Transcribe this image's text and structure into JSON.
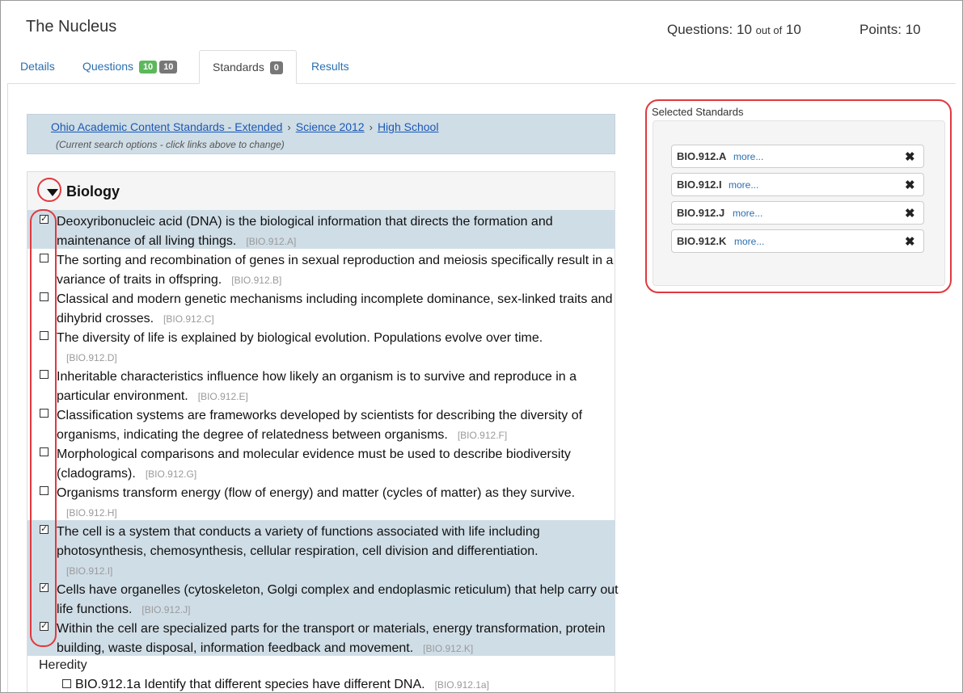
{
  "header": {
    "title": "The Nucleus",
    "questions_label": "Questions:",
    "questions_count": "10",
    "questions_outof": "out of",
    "questions_total": "10",
    "points_label": "Points:",
    "points_value": "10"
  },
  "tabs": [
    {
      "label": "Details"
    },
    {
      "label": "Questions",
      "badge_green": "10",
      "badge_gray": "10"
    },
    {
      "label": "Standards",
      "badge_gray": "0"
    },
    {
      "label": "Results"
    }
  ],
  "breadcrumb": {
    "items": [
      "Ohio Academic Content Standards - Extended",
      "Science 2012",
      "High School"
    ],
    "note": "(Current search options - click links above to change)"
  },
  "panel": {
    "title": "Biology"
  },
  "standards": [
    {
      "text": "Deoxyribonucleic acid (DNA) is the biological information that directs the formation and maintenance of all living things.",
      "code": "[BIO.912.A]",
      "checked": true
    },
    {
      "text": "The sorting and recombination of genes in sexual reproduction and meiosis specifically result in a variance of traits in offspring.",
      "code": "[BIO.912.B]",
      "checked": false
    },
    {
      "text": "Classical and modern genetic mechanisms including incomplete dominance, sex-linked traits and dihybrid crosses.",
      "code": "[BIO.912.C]",
      "checked": false
    },
    {
      "text": "The diversity of life is explained by biological evolution. Populations evolve over time.",
      "code": "[BIO.912.D]",
      "checked": false
    },
    {
      "text": "Inheritable characteristics influence how likely an organism is to survive and reproduce in a particular environment.",
      "code": "[BIO.912.E]",
      "checked": false
    },
    {
      "text": "Classification systems are frameworks developed by scientists for describing the diversity of organisms, indicating the degree of relatedness between organisms.",
      "code": "[BIO.912.F]",
      "checked": false
    },
    {
      "text": "Morphological comparisons and molecular evidence must be used to describe biodiversity (cladograms).",
      "code": "[BIO.912.G]",
      "checked": false
    },
    {
      "text": "Organisms transform energy (flow of energy) and matter (cycles of matter) as they survive.",
      "code": "[BIO.912.H]",
      "checked": false
    },
    {
      "text": "The cell is a system that conducts a variety of functions associated with life including photosynthesis, chemosynthesis, cellular respiration, cell division and differentiation.",
      "code": "[BIO.912.I]",
      "checked": true
    },
    {
      "text": "Cells have organelles (cytoskeleton, Golgi complex and endoplasmic reticulum) that help carry out life functions.",
      "code": "[BIO.912.J]",
      "checked": true
    },
    {
      "text": "Within the cell are specialized parts for the transport or materials, energy transformation, protein building, waste disposal, information feedback and movement.",
      "code": "[BIO.912.K]",
      "checked": true
    }
  ],
  "subgroup": {
    "label": "Heredity",
    "item": {
      "text": "BIO.912.1a Identify that different species have different DNA.",
      "code": "[BIO.912.1a]"
    }
  },
  "selected": {
    "label": "Selected Standards",
    "more_label": "more...",
    "remove_icon": "times-icon",
    "items": [
      "BIO.912.A",
      "BIO.912.I",
      "BIO.912.J",
      "BIO.912.K"
    ]
  },
  "colors": {
    "highlight_row": "#cfdde6",
    "annotation": "#e0393e",
    "link": "#2a6fb0",
    "badge_green": "#5cb85c",
    "badge_gray": "#777777"
  }
}
